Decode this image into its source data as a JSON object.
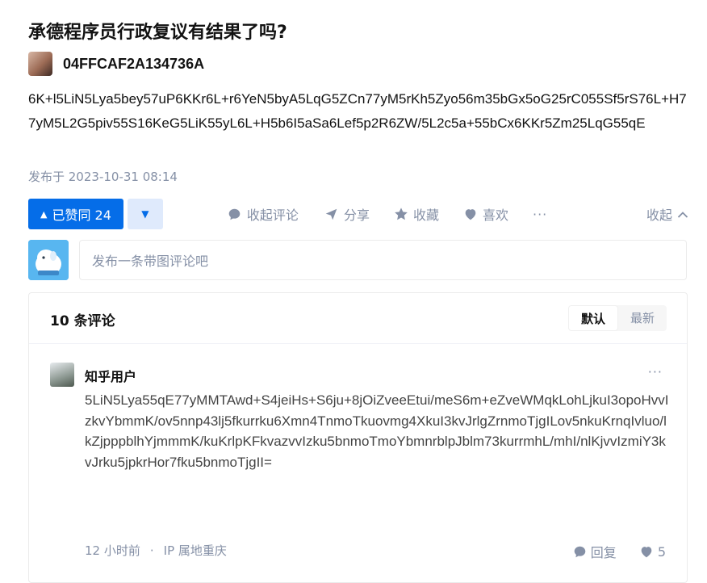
{
  "question": {
    "title": "承德程序员行政复议有结果了吗?"
  },
  "author": {
    "name": "04FFCAF2A134736A"
  },
  "answer": {
    "content": "6K+l5LiN5Lya5bey57uP6KKr6L+r6YeN5byA5LqG5ZCn77yM5rKh5Zyo56m35bGx5oG25rC055Sf5rS76L+H77yM5L2G5piv55S16KeG5LiK55yL6L+H5b6I5aSa6Lef5p2R6ZW/5L2c5a+55bCx6KKr5Zm25LqG55qE",
    "published": "发布于 2023-10-31 08:14"
  },
  "actions": {
    "upvote_label": "已赞同 24",
    "upvote_icon": "triangle-up-icon",
    "downvote_icon": "triangle-down-icon",
    "comment_label": "收起评论",
    "share_label": "分享",
    "favorite_label": "收藏",
    "like_label": "喜欢",
    "more_label": "···",
    "collapse_label": "收起"
  },
  "comment_input": {
    "placeholder": "发布一条带图评论吧"
  },
  "comments": {
    "count_label": "10 条评论",
    "sort_default": "默认",
    "sort_latest": "最新",
    "items": [
      {
        "user": "知乎用户",
        "text": "5LiN5Lya55qE77yMMTAwd+S4jeiHs+S6ju+8jOiZveeEtui/meS6m+eZveWMqkLohLjkuI3opoHvvIzkvYbmmK/ov5nnp43lj5fkurrku6Xmn4TnmoTkuovmg4XkuI3kvJrlgZrnmoTjgILov5nkuKrnqIvluo/lkZjpppblhYjmmmK/kuKrlpKFkvazvvIzku5bnmoTmoYbmnrblpJblm73kurrmhL/mhI/nlKjvvIzmiY3kvJrku5jpkrHor7fku5bnmoTjgII=",
        "time": "12 小时前",
        "dot": "·",
        "ip": "IP 属地重庆",
        "more_label": "···",
        "reply_label": "回复",
        "like_count": "5"
      }
    ]
  },
  "colors": {
    "primary": "#056de8",
    "muted": "#8590a6",
    "text": "#121212"
  }
}
